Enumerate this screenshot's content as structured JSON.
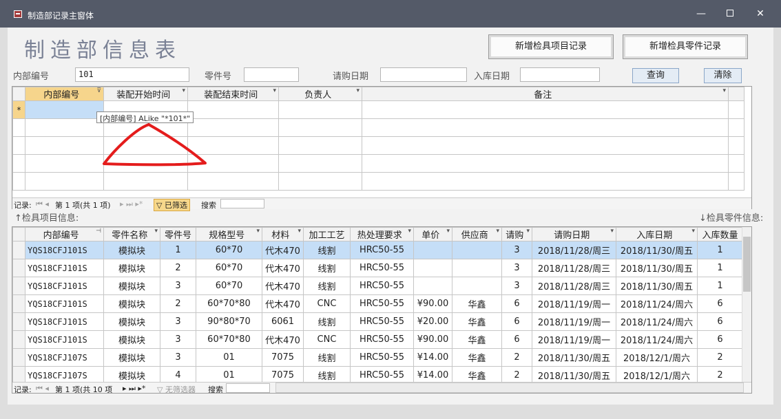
{
  "window": {
    "title": "制造部记录主窗体"
  },
  "header": {
    "title": "制造部信息表",
    "btn_new_project": "新增检具项目记录",
    "btn_new_part": "新增检具零件记录"
  },
  "search": {
    "label_id": "内部编号",
    "value_id": "101",
    "label_part": "零件号",
    "value_part": "",
    "label_purchase": "请购日期",
    "value_purchase": "",
    "label_stock": "入库日期",
    "value_stock": "",
    "query_label": "查询",
    "clear_label": "清除"
  },
  "top_table": {
    "columns": [
      "内部编号",
      "装配开始时间",
      "装配结束时间",
      "负责人",
      "备注"
    ],
    "new_row_marker": "*",
    "tooltip": "[内部编号] ALike \"*101*\"",
    "nav": {
      "record": "记录:",
      "position": "第 1 项(共 1 项)",
      "filter": "已筛选",
      "search": "搜索"
    }
  },
  "section_labels": {
    "project_info": "↑检具项目信息:",
    "part_info": "↓检具零件信息:"
  },
  "bottom_table": {
    "columns": [
      "内部编号",
      "零件名称",
      "零件号",
      "规格型号",
      "材料",
      "加工工艺",
      "热处理要求",
      "单价",
      "供应商",
      "请购",
      "请购日期",
      "入库日期",
      "入库数量"
    ],
    "headers": [
      "内部编号",
      "零件名称",
      "零件号",
      "规格型号",
      "材料",
      "加工工艺",
      "热处理要求",
      "单价",
      "供应商",
      "请购",
      "请购日期",
      "入库日期",
      "入库数量"
    ],
    "rows": [
      [
        "YQS18CFJ101S",
        "模拟块",
        "1",
        "60*70",
        "代木470",
        "线割",
        "HRC50-55",
        "",
        "",
        "3",
        "2018/11/28/周三",
        "2018/11/30/周五",
        "1"
      ],
      [
        "YQS18CFJ101S",
        "模拟块",
        "2",
        "60*70",
        "代木470",
        "线割",
        "HRC50-55",
        "",
        "",
        "3",
        "2018/11/28/周三",
        "2018/11/30/周五",
        "1"
      ],
      [
        "YQS18CFJ101S",
        "模拟块",
        "3",
        "60*70",
        "代木470",
        "线割",
        "HRC50-55",
        "",
        "",
        "3",
        "2018/11/28/周三",
        "2018/11/30/周五",
        "1"
      ],
      [
        "YQS18CFJ101S",
        "模拟块",
        "2",
        "60*70*80",
        "代木470",
        "CNC",
        "HRC50-55",
        "¥90.00",
        "华鑫",
        "6",
        "2018/11/19/周一",
        "2018/11/24/周六",
        "6"
      ],
      [
        "YQS18CFJ101S",
        "模拟块",
        "3",
        "90*80*70",
        "6061",
        "线割",
        "HRC50-55",
        "¥20.00",
        "华鑫",
        "6",
        "2018/11/19/周一",
        "2018/11/24/周六",
        "6"
      ],
      [
        "YQS18CFJ101S",
        "模拟块",
        "3",
        "60*70*80",
        "代木470",
        "CNC",
        "HRC50-55",
        "¥90.00",
        "华鑫",
        "6",
        "2018/11/19/周一",
        "2018/11/24/周六",
        "6"
      ],
      [
        "YQS18CFJ107S",
        "模拟块",
        "3",
        "01",
        "7075",
        "线割",
        "HRC50-55",
        "¥14.00",
        "华鑫",
        "2",
        "2018/11/30/周五",
        "2018/12/1/周六",
        "2"
      ],
      [
        "YQS18CFJ107S",
        "模拟块",
        "4",
        "01",
        "7075",
        "线割",
        "HRC50-55",
        "¥14.00",
        "华鑫",
        "2",
        "2018/11/30/周五",
        "2018/12/1/周六",
        "2"
      ]
    ],
    "nav": {
      "record": "记录:",
      "position": "第 1 项(共 10 项",
      "filter": "无筛选器",
      "search": "搜索"
    }
  }
}
